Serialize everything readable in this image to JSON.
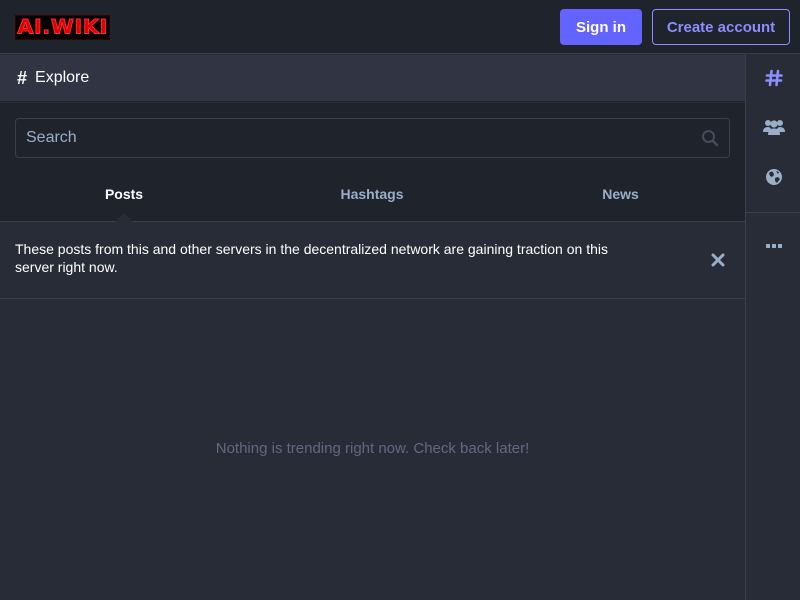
{
  "header": {
    "logo_text": "AI.WIKI",
    "sign_in_label": "Sign in",
    "create_account_label": "Create account"
  },
  "column": {
    "icon": "hashtag-icon",
    "title": "Explore"
  },
  "search": {
    "placeholder": "Search"
  },
  "tabs": [
    {
      "label": "Posts",
      "active": true
    },
    {
      "label": "Hashtags",
      "active": false
    },
    {
      "label": "News",
      "active": false
    }
  ],
  "notice": {
    "text": "These posts from this and other servers in the decentralized network are gaining traction on this server right now."
  },
  "empty_state": "Nothing is trending right now. Check back later!",
  "sidebar": {
    "items": [
      {
        "icon": "hashtag-icon",
        "active": true
      },
      {
        "icon": "users-icon",
        "active": false
      },
      {
        "icon": "globe-icon",
        "active": false
      },
      {
        "icon": "ellipsis-icon",
        "active": false
      }
    ]
  },
  "colors": {
    "accent": "#6364ff",
    "accent_light": "#8c8dff",
    "background": "#282c37",
    "panel": "#1f232b",
    "muted_text": "#9baec8",
    "dim_text": "#606984",
    "logo_red": "#e00000"
  }
}
